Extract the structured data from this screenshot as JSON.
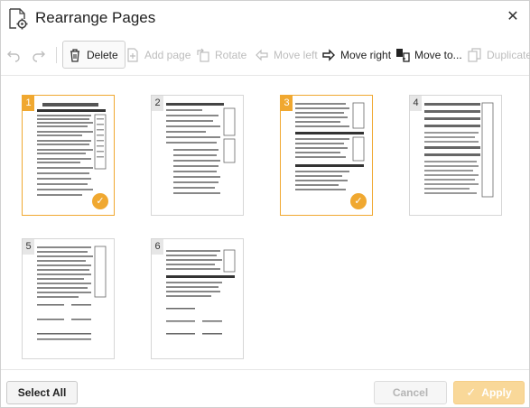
{
  "dialog": {
    "title": "Rearrange Pages",
    "close_glyph": "✕"
  },
  "toolbar": {
    "undo_icon": "undo-icon",
    "redo_icon": "redo-icon",
    "delete_label": "Delete",
    "add_page_label": "Add page",
    "rotate_label": "Rotate",
    "move_left_label": "Move left",
    "move_right_label": "Move right",
    "move_to_label": "Move to...",
    "duplicate_label": "Duplicate"
  },
  "pages": [
    {
      "number": "1",
      "selected": true
    },
    {
      "number": "2",
      "selected": false
    },
    {
      "number": "3",
      "selected": true
    },
    {
      "number": "4",
      "selected": false
    },
    {
      "number": "5",
      "selected": false
    },
    {
      "number": "6",
      "selected": false
    }
  ],
  "check_glyph": "✓",
  "footer": {
    "select_all_label": "Select All",
    "cancel_label": "Cancel",
    "apply_label": "Apply",
    "apply_glyph": "✓"
  },
  "colors": {
    "accent": "#f0a830",
    "accent_light": "#f9d899",
    "disabled_text": "#bdbdbd"
  }
}
